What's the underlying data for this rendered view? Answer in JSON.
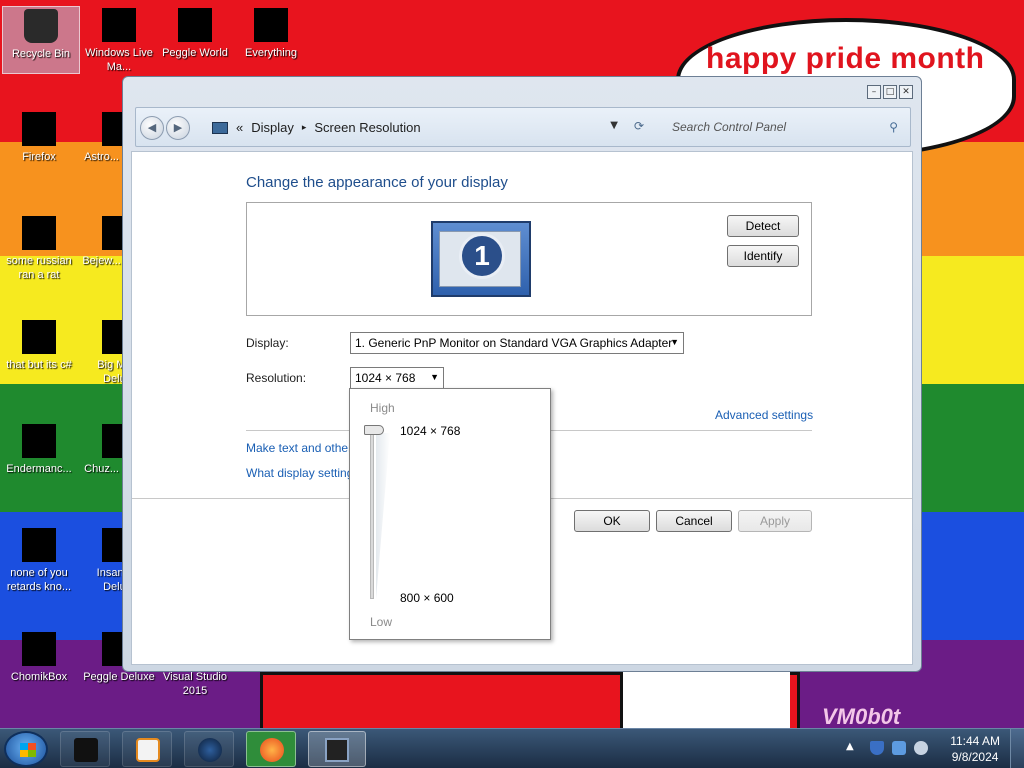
{
  "desktop": {
    "bubble_text": "happy pride month",
    "watermark": "VM0b0t",
    "icons": [
      {
        "label": "Recycle Bin"
      },
      {
        "label": "Windows Live Ma..."
      },
      {
        "label": "Peggle World"
      },
      {
        "label": "Everything"
      },
      {
        "label": "Firefox"
      },
      {
        "label": "Astro... Delu..."
      },
      {
        "label": "some russian ran a rat"
      },
      {
        "label": "Bejew... Delu..."
      },
      {
        "label": "that but its c#"
      },
      {
        "label": "Big Mo... Delu..."
      },
      {
        "label": "Endermanc..."
      },
      {
        "label": "Chuz... Delu..."
      },
      {
        "label": "none of you retards kno..."
      },
      {
        "label": "Insaniq... Delu..."
      },
      {
        "label": "ChomikBox"
      },
      {
        "label": "Peggle Deluxe"
      },
      {
        "label": "Visual Studio 2015"
      }
    ]
  },
  "window": {
    "breadcrumb": {
      "overflow": "«",
      "items": [
        "Display",
        "Screen Resolution"
      ],
      "separator": "▸"
    },
    "search_placeholder": "Search Control Panel",
    "heading": "Change the appearance of your display",
    "monitor_number": "1",
    "detect_label": "Detect",
    "identify_label": "Identify",
    "display_label": "Display:",
    "display_value": "1. Generic PnP Monitor on Standard VGA Graphics Adapter",
    "resolution_label": "Resolution:",
    "resolution_value": "1024 × 768",
    "advanced_link": "Advanced settings",
    "link_text_size": "Make text and other",
    "link_display_settings": "What display setting",
    "ok_label": "OK",
    "cancel_label": "Cancel",
    "apply_label": "Apply"
  },
  "resolution_popup": {
    "high_label": "High",
    "low_label": "Low",
    "top_value": "1024 × 768",
    "bottom_value": "800 × 600",
    "slider_position": 1.0
  },
  "taskbar": {
    "time": "11:44 AM",
    "date": "9/8/2024"
  },
  "colors": {
    "accent": "#1f4e8c",
    "link": "#1a5fb4"
  }
}
